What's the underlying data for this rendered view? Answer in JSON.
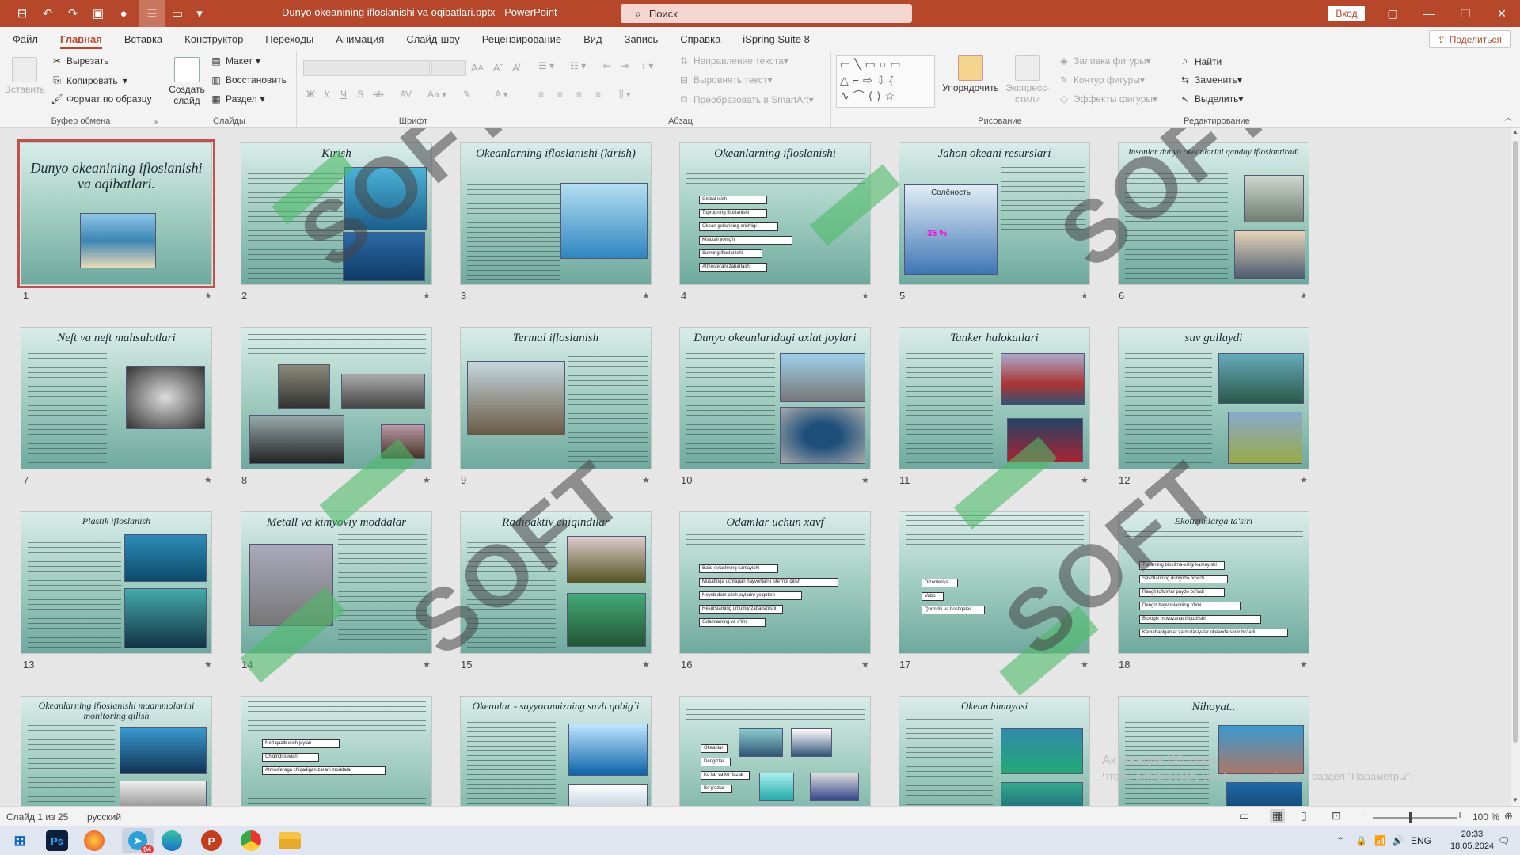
{
  "titlebar": {
    "doc_title": "Dunyo okeanining  ifloslanishi va oqibatlari.pptx  -  PowerPoint",
    "search_placeholder": "Поиск",
    "signin": "Вход"
  },
  "menu": {
    "items": [
      "Файл",
      "Главная",
      "Вставка",
      "Конструктор",
      "Переходы",
      "Анимация",
      "Слайд-шоу",
      "Рецензирование",
      "Вид",
      "Запись",
      "Справка",
      "iSpring Suite 8"
    ],
    "active_index": 1,
    "share": "Поделиться"
  },
  "ribbon": {
    "clipboard": {
      "label": "Буфер обмена",
      "paste": "Вставить",
      "cut": "Вырезать",
      "copy": "Копировать",
      "format": "Формат по образцу"
    },
    "slides": {
      "label": "Слайды",
      "new_slide": "Создать слайд",
      "layout": "Макет",
      "reset": "Восстановить",
      "section": "Раздел"
    },
    "font": {
      "label": "Шрифт"
    },
    "paragraph": {
      "label": "Абзац",
      "direction": "Направление текста",
      "align": "Выровнять текст",
      "smartart": "Преобразовать в SmartArt"
    },
    "drawing": {
      "label": "Рисование",
      "arrange": "Упорядочить",
      "quick_styles": "Экспресс-стили",
      "fill": "Заливка фигуры",
      "outline": "Контур фигуры",
      "effects": "Эффекты фигуры"
    },
    "editing": {
      "label": "Редактирование",
      "find": "Найти",
      "replace": "Заменить",
      "select": "Выделить"
    }
  },
  "slides": [
    {
      "num": "1",
      "title": "Dunyo okeanining ifloslanishi va oqibatlari."
    },
    {
      "num": "2",
      "title": "Kirish"
    },
    {
      "num": "3",
      "title": "Okeanlarning ifloslanishi (kirish)"
    },
    {
      "num": "4",
      "title": "Okeanlarning ifloslanishi",
      "boxes": [
        "Global isish",
        "Toprogning ifloslanishi",
        "Okean gellarining erishligi",
        "Kislotali yomg'ir",
        "Suvning ifloslanishi",
        "Atmosferani zaharlash"
      ]
    },
    {
      "num": "5",
      "title": "Jahon okeani resurslari",
      "caption": "Солёность",
      "percent": "35 %"
    },
    {
      "num": "6",
      "title": "Insonlar dunyo okeanlarini qanday ifloslantiradi"
    },
    {
      "num": "7",
      "title": "Neft va neft mahsulotlari"
    },
    {
      "num": "8",
      "title": ""
    },
    {
      "num": "9",
      "title": "Termal ifloslanish"
    },
    {
      "num": "10",
      "title": "Dunyo okeanlaridagi axlat joylari"
    },
    {
      "num": "11",
      "title": "Tanker halokatlari"
    },
    {
      "num": "12",
      "title": "suv gullaydi"
    },
    {
      "num": "13",
      "title": "Plastik ifloslanish"
    },
    {
      "num": "14",
      "title": "Metall va kimyoviy moddalar"
    },
    {
      "num": "15",
      "title": "Radioaktiv chiqindilar"
    },
    {
      "num": "16",
      "title": "Odamlar uchun xavf",
      "boxes": [
        "Baliq ovlashning kamayishi",
        "Musaffoga uchragan hayvonlarni iste'mol qilish",
        "Noyob dam olish joylarini yo'qotish",
        "Resurslarning umumiy zaharlanishi",
        "Odamlarning va o'limi"
      ]
    },
    {
      "num": "17",
      "title": "",
      "boxes": [
        "Dizenteriya",
        "Vabo",
        "Qorin tifi va boshqalar."
      ]
    },
    {
      "num": "18",
      "title": "Ekotizimlarga ta'siri",
      "boxes": [
        "Turlarning bioxilma-xilligi kamayishi",
        "Savollarining dunyoda hovuzi",
        "Rangli to'lqinlar paydo bo'ladi",
        "Dengiz hayvonlarining o'limi",
        "Biologik muvozanatni buzilishi",
        "Kamahaolganlar va mutasiyalar okeanda sodir bo'ladi"
      ]
    },
    {
      "num": "19",
      "title": "Okeanlarning ifloslanishi muammolarini monitoring qilish"
    },
    {
      "num": "20",
      "title": "",
      "boxes": [
        "Neft qazib olish joylari",
        "Chiqindi suvlari",
        "Atmosferaga chiqadigan zararli moddalar"
      ]
    },
    {
      "num": "21",
      "title": "Okeanlar - sayyoramizning suvli qobig`i"
    },
    {
      "num": "22",
      "title": "",
      "boxes": [
        "Okeanlar",
        "Dengizlar",
        "Ko'llar va ko'rfazlar",
        "Bo'g'ozlar"
      ]
    },
    {
      "num": "23",
      "title": "Okean himoyasi"
    },
    {
      "num": "24",
      "title": "Nihoyat.."
    }
  ],
  "watermark": "SOFT",
  "activation": {
    "line1": "Активация Windows",
    "line2": "Чтобы активировать Windows, перейдите в раздел \"Параметры\"."
  },
  "status": {
    "slide_info": "Слайд 1 из 25",
    "language": "русский",
    "zoom": "100 %"
  },
  "taskbar": {
    "lang": "ENG",
    "time": "20:33",
    "date": "18.05.2024",
    "telegram_badge": "94"
  },
  "colors": {
    "accent": "#b7472a",
    "selection": "#c0504d",
    "watermark_green": "#4cbb67"
  }
}
